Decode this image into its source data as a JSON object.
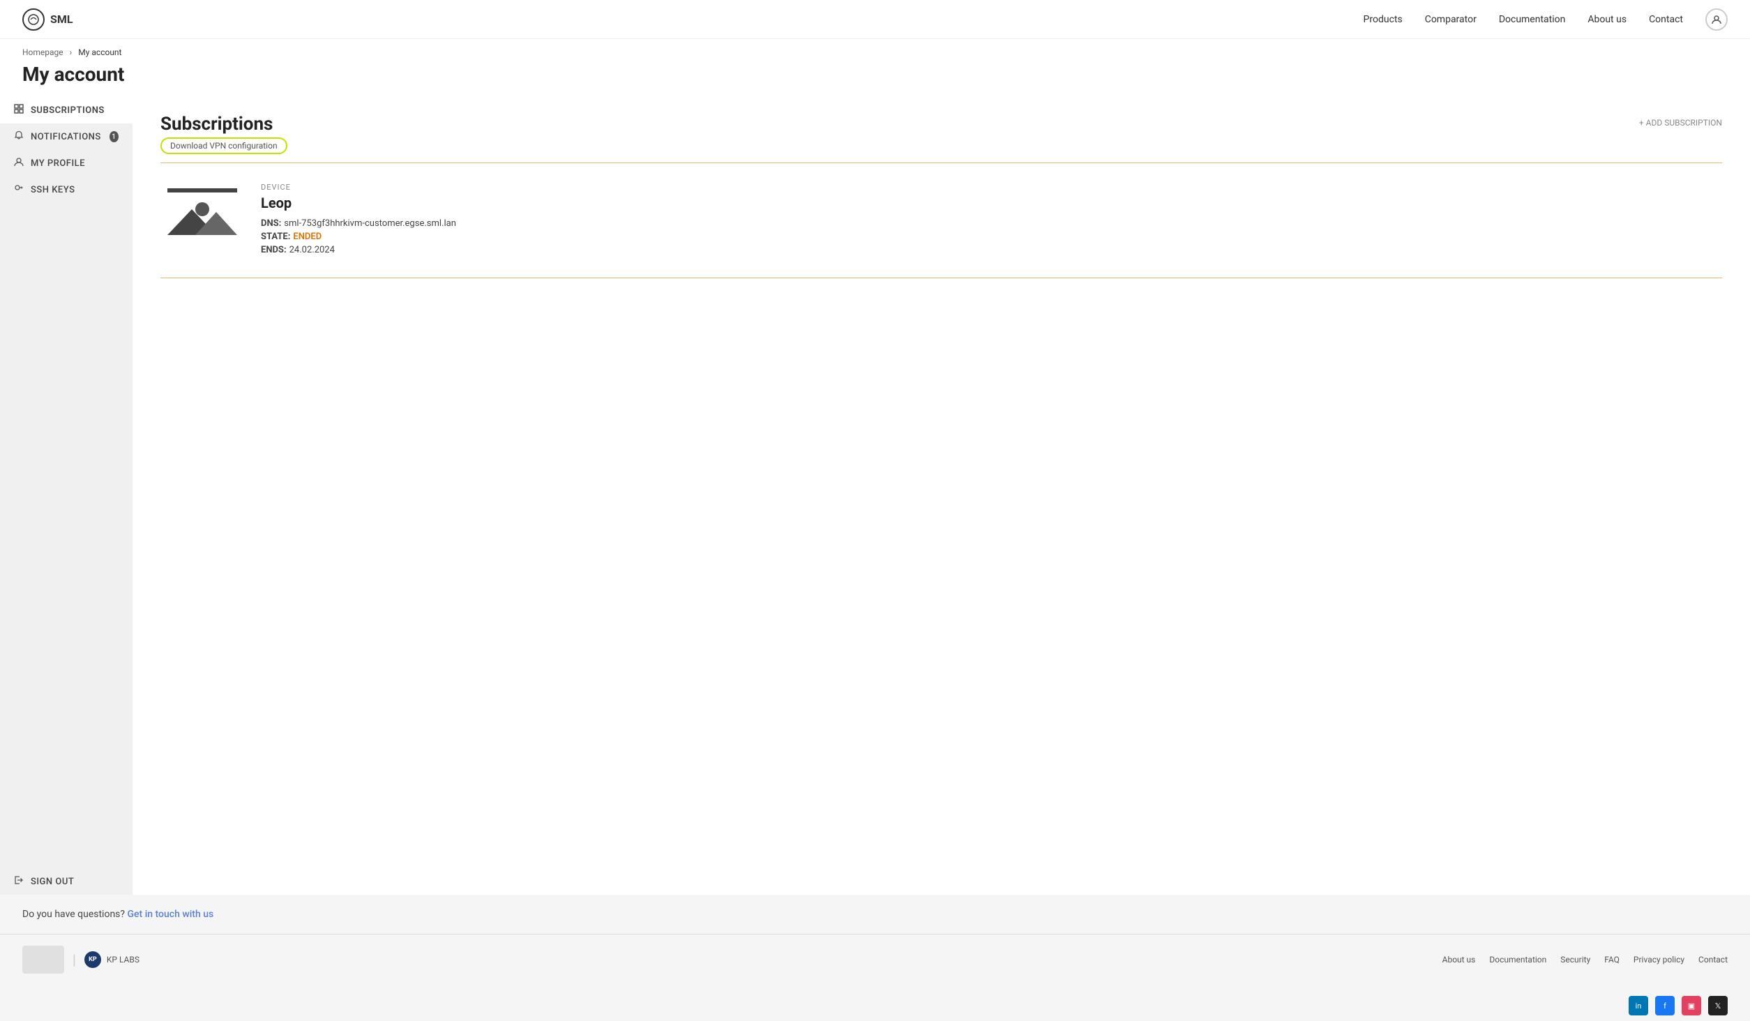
{
  "header": {
    "logo_text": "SML",
    "nav": [
      {
        "label": "Products",
        "href": "#"
      },
      {
        "label": "Comparator",
        "href": "#"
      },
      {
        "label": "Documentation",
        "href": "#"
      },
      {
        "label": "About us",
        "href": "#"
      },
      {
        "label": "Contact",
        "href": "#"
      }
    ]
  },
  "breadcrumb": {
    "home": "Homepage",
    "current": "My account"
  },
  "page": {
    "title": "My account"
  },
  "sidebar": {
    "items": [
      {
        "id": "subscriptions",
        "label": "Subscriptions",
        "icon": "grid",
        "active": true,
        "badge": null
      },
      {
        "id": "notifications",
        "label": "Notifications",
        "icon": "bell",
        "active": false,
        "badge": "1"
      },
      {
        "id": "my-profile",
        "label": "My Profile",
        "icon": "user",
        "active": false,
        "badge": null
      },
      {
        "id": "ssh-keys",
        "label": "SSH Keys",
        "icon": "key",
        "active": false,
        "badge": null
      }
    ],
    "signout_label": "Sign Out"
  },
  "main": {
    "section_title": "Subscriptions",
    "download_vpn_label": "Download VPN configuration",
    "add_subscription_label": "+ ADD SUBSCRIPTION",
    "device": {
      "label": "DEVICE",
      "name": "Leop",
      "dns_label": "DNS:",
      "dns_value": "sml-753gf3hhrkivm-customer.egse.sml.lan",
      "state_label": "STATE:",
      "state_value": "ENDED",
      "ends_label": "ENDS:",
      "ends_value": "24.02.2024"
    }
  },
  "footer": {
    "question_text": "Do you have questions?",
    "contact_link": "Get in touch with us",
    "links": [
      {
        "label": "About us"
      },
      {
        "label": "Documentation"
      },
      {
        "label": "Security"
      },
      {
        "label": "FAQ"
      },
      {
        "label": "Privacy policy"
      },
      {
        "label": "Contact"
      }
    ],
    "social": [
      {
        "name": "linkedin",
        "symbol": "in"
      },
      {
        "name": "facebook",
        "symbol": "f"
      },
      {
        "name": "instagram",
        "symbol": "ig"
      },
      {
        "name": "twitter",
        "symbol": "𝕏"
      }
    ]
  }
}
